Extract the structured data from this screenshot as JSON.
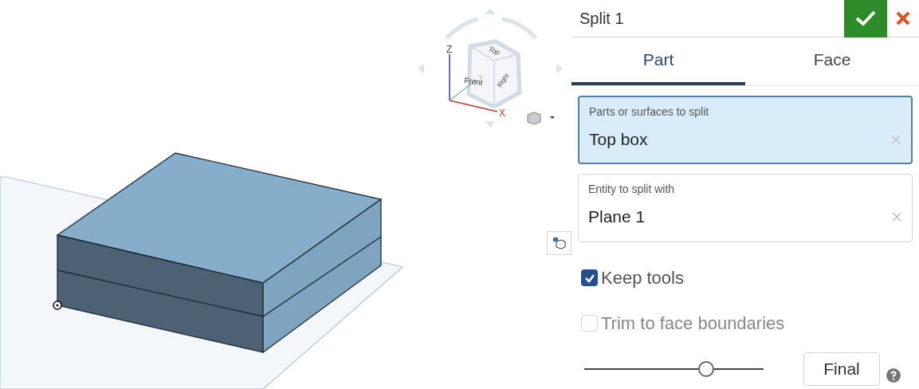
{
  "view_cube": {
    "faces": [
      "Top",
      "Front",
      "Right"
    ],
    "axes": [
      "Z",
      "Y",
      "X"
    ]
  },
  "panel": {
    "title": "Split 1",
    "tabs": [
      {
        "label": "Part",
        "selected": true
      },
      {
        "label": "Face",
        "selected": false
      }
    ],
    "fields": [
      {
        "label": "Parts or surfaces to split",
        "value": "Top box",
        "active": true
      },
      {
        "label": "Entity to split with",
        "value": "Plane 1",
        "active": false
      }
    ],
    "options": [
      {
        "label": "Keep tools",
        "checked": true
      },
      {
        "label": "Trim to face boundaries",
        "checked": false
      }
    ],
    "slider": {
      "level": 0.68
    },
    "final_button": "Final"
  }
}
